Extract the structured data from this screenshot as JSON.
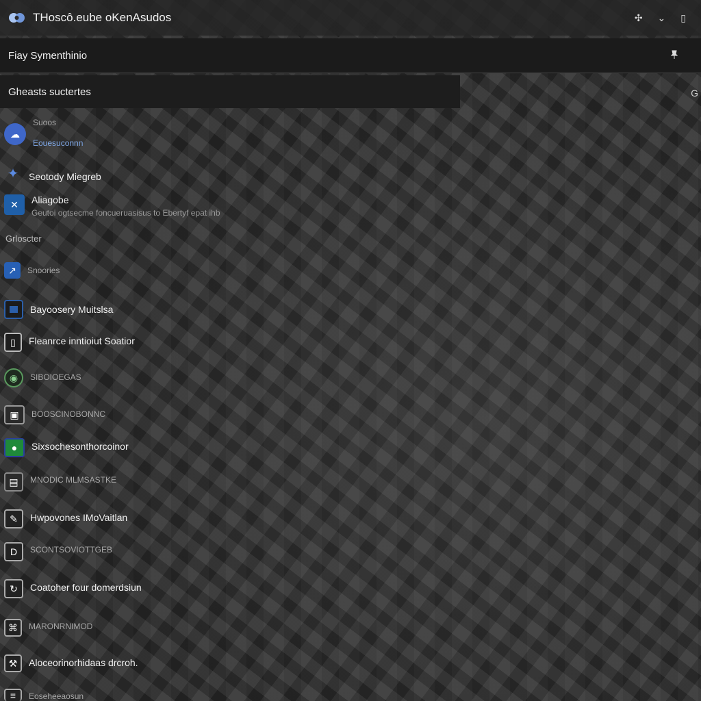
{
  "header": {
    "title": "THoscô.eube oKenAsudos",
    "actions": [
      "✣",
      "⌄",
      "▯"
    ]
  },
  "bar2": {
    "label": "Fiay Symenthinio",
    "pin_icon": "pin-icon"
  },
  "bar3": {
    "label": "Gheasts suctertes",
    "right_glyph": "G"
  },
  "section": {
    "label": "Grloscter"
  },
  "items": [
    {
      "main": "Suoos",
      "sub": "Eouesuconnn",
      "icon": "cloud-icon",
      "color": "#3f67c9"
    },
    {
      "main": "Seotody Miegreb",
      "icon": "puzzle-icon",
      "color": "#3a66c4"
    },
    {
      "main": "Aliagobe",
      "sub": "Geutoi ogtsecme foncueruasisus to Ebertyf epat ihb",
      "icon": "vscode-icon",
      "color": "#1f5fa8"
    },
    {
      "main": "Snoories",
      "icon": "arrow-icon",
      "color": "#2760b5"
    },
    {
      "main": "Bayoosery Muitslsa",
      "icon": "window-icon",
      "color": "#2b5ea8"
    },
    {
      "main": "Fleanrce inntioiut Soatior",
      "icon": "doc-icon",
      "color": "#3b3b3b"
    },
    {
      "main": "SIBOIOEGAS",
      "icon": "circle-icon",
      "color": "#2f6e3a"
    },
    {
      "main": "BOOSCINOBONNC",
      "icon": "folder-icon",
      "color": "#4a4a4a"
    },
    {
      "main": "Sixsochesonthorcoinor",
      "icon": "app-green-icon",
      "color": "#1f8a3a"
    },
    {
      "main": "MNODIC MLMSASTKE",
      "icon": "box-icon",
      "color": "#3e3e3e"
    },
    {
      "main": "Hwpovones IMoVaitlan",
      "icon": "image-icon",
      "color": "#3b3b3b"
    },
    {
      "main": "SCONTSOVIOTTGEB",
      "icon": "slash-icon",
      "color": "#3a3a3a"
    },
    {
      "main": "Coatoher four domerdsiun",
      "icon": "edit-icon",
      "color": "#3a3a3a"
    },
    {
      "main": "MARONRNIMOD",
      "icon": "link-icon",
      "color": "#3a3a3a"
    },
    {
      "main": "Aloceorinorhidaas drcroh.",
      "icon": "tool-icon",
      "color": "#3a3a3a"
    },
    {
      "main": "Eoseheeaosun",
      "icon": "layers-icon",
      "color": "#3a3a3a"
    }
  ]
}
